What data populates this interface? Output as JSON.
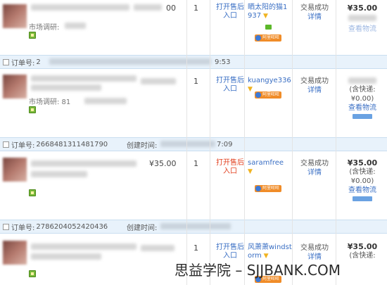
{
  "labels": {
    "order_no": "订单号:",
    "create_time": "创建时间:",
    "after_sale": "打开售后入口",
    "snapshot_hint": "市场调研:",
    "status_success": "交易成功",
    "details": "详情",
    "includes_shipping": "(含快递:",
    "shipping_zero": "¥0.00)",
    "view_logistics": "查看物流",
    "badge_text": "阿里旺旺"
  },
  "orders": [
    {
      "order_no": "",
      "time": "",
      "item_subtext": "市场调研:",
      "price": "",
      "price_tail": "00",
      "qty": "1",
      "after_sale": "打开售后入口",
      "after_sale_color": "blue",
      "buyer": "晒太阳的猫1937",
      "status": "交易成功",
      "details": "详情",
      "total": "¥35.00",
      "logistics": "查看物流"
    },
    {
      "order_no": "2",
      "time": "9:53",
      "item_subtext": "市场调研: 81",
      "price": "",
      "qty": "1",
      "after_sale": "打开售后入口",
      "after_sale_color": "blue",
      "buyer": "kuangye336",
      "status": "交易成功",
      "details": "详情",
      "total": "",
      "logistics": "查看物流"
    },
    {
      "order_no": "2668481311481790",
      "time": "7:09",
      "item_subtext": "",
      "price": "¥35.00",
      "qty": "1",
      "after_sale": "打开售后入口",
      "after_sale_color": "red",
      "buyer": "saramfree",
      "status": "交易成功",
      "details": "详情",
      "total": "¥35.00",
      "logistics": "查看物流"
    },
    {
      "order_no": "2786204052420436",
      "time": "",
      "item_subtext": "",
      "price": "",
      "qty": "1",
      "after_sale": "打开售后入口",
      "after_sale_color": "blue",
      "buyer": "风萧萧windstorm",
      "status": "交易成功",
      "details": "详情",
      "total": "¥35.00",
      "logistics": ""
    }
  ],
  "watermark": "思益学院 – SJJBANK.COM",
  "colors": {
    "link_blue": "#3a6fc4",
    "alert_red": "#e2401f",
    "bar_bg": "#e8f2fb",
    "badge_orange": "#f08c28",
    "snapshot_green": "#78b83a"
  }
}
